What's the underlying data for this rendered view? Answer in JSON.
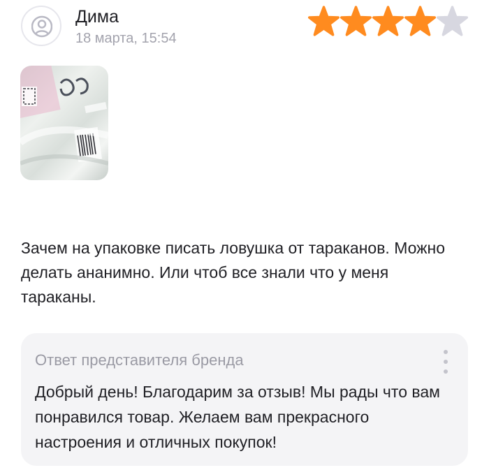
{
  "review": {
    "author": "Дима",
    "date": "18 марта, 15:54",
    "rating": 4,
    "rating_max": 5,
    "text": "Зачем на упаковке писать ловушка от тараканов. Можно делать ананимно. Или чтоб все знали что у меня тараканы.",
    "icons": {
      "avatar": "user-avatar-icon",
      "star": "star-icon"
    }
  },
  "brand_response": {
    "title": "Ответ представителя бренда",
    "text": "Добрый день! Благодарим за отзыв! Мы рады что вам понравился товар. Желаем вам прекрасного настроения и отличных покупок!",
    "menu_icon": "more-vertical-icon"
  },
  "colors": {
    "star_filled": "#FF8B1F",
    "star_empty": "#D7D7E0",
    "secondary_text": "#A3A3AD",
    "response_bg": "#F4F4F6"
  }
}
